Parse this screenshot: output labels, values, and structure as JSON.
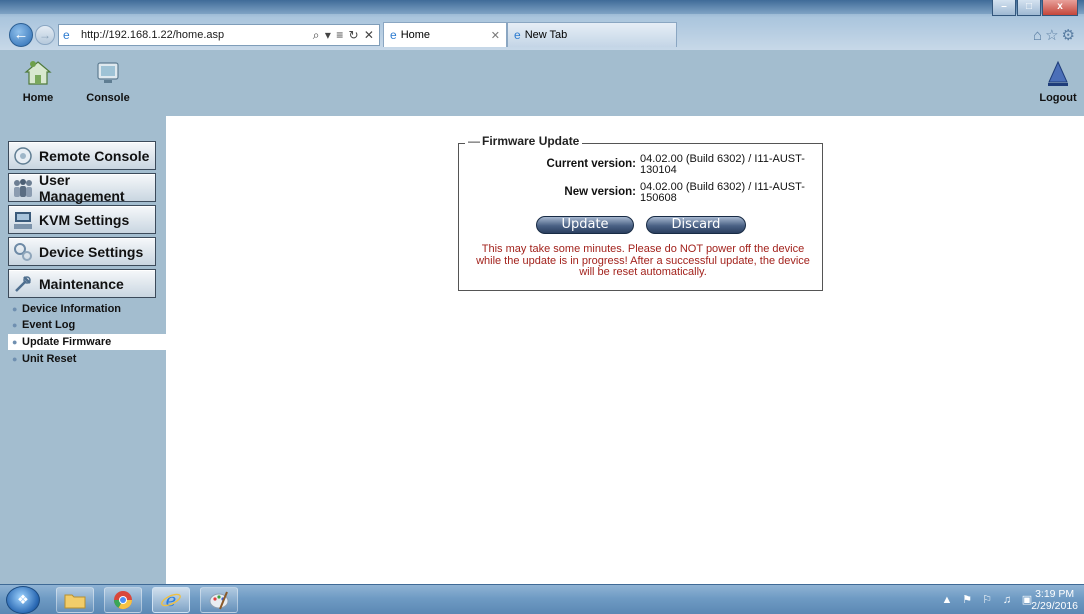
{
  "browser": {
    "url": "http://192.168.1.22/home.asp",
    "address_tools": "⌕ ▾ ≡ ↻ ✕",
    "tabs": [
      {
        "label": "Home",
        "active": true
      },
      {
        "label": "New Tab",
        "active": false
      }
    ],
    "window_controls": {
      "minimize": "–",
      "maximize": "□",
      "close": "x"
    }
  },
  "header": {
    "home_label": "Home",
    "console_label": "Console",
    "logout_label": "Logout"
  },
  "sidebar": {
    "menu": [
      {
        "label": "Remote Console",
        "icon": "remote-console-icon"
      },
      {
        "label": "User Management",
        "icon": "users-icon"
      },
      {
        "label": "KVM Settings",
        "icon": "kvm-icon"
      },
      {
        "label": "Device Settings",
        "icon": "device-settings-icon"
      },
      {
        "label": "Maintenance",
        "icon": "maintenance-icon"
      }
    ],
    "submenu": [
      {
        "label": "Device Information",
        "active": false
      },
      {
        "label": "Event Log",
        "active": false
      },
      {
        "label": "Update Firmware",
        "active": true
      },
      {
        "label": "Unit Reset",
        "active": false
      }
    ]
  },
  "firmware": {
    "legend": "Firmware Update",
    "current_label": "Current version:",
    "current_value": "04.02.00 (Build 6302) / I11-AUST-130104",
    "new_label": "New version:",
    "new_value": "04.02.00 (Build 6302) / I11-AUST-150608",
    "update_button": "Update",
    "discard_button": "Discard",
    "warning": "This may take some minutes. Please do NOT power off the device while the update is in progress! After a successful update, the device will be reset automatically."
  },
  "taskbar": {
    "time": "3:19 PM",
    "date": "2/29/2016"
  },
  "colors": {
    "sidebar_bg": "#a3bdcf",
    "warning_text": "#a3231d",
    "button_dark": "#2b3f5f"
  }
}
